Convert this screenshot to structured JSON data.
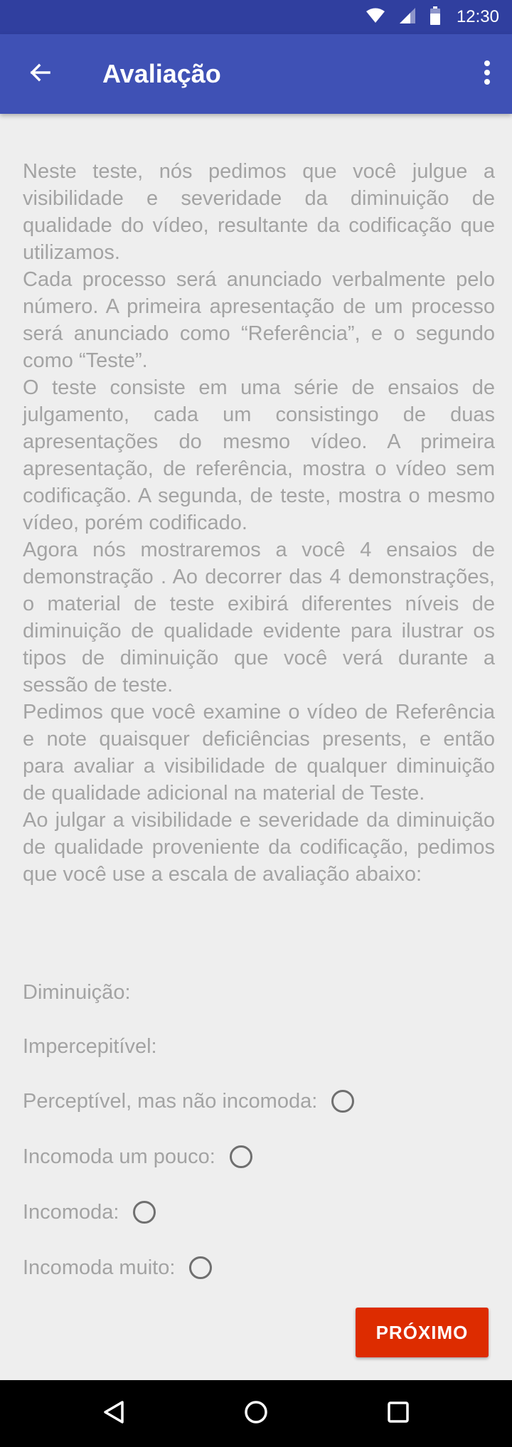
{
  "status_bar": {
    "time": "12:30",
    "icons": [
      "wifi-icon",
      "signal-icon",
      "battery-icon"
    ]
  },
  "app_bar": {
    "title": "Avaliação",
    "back_icon": "arrow-back-icon",
    "menu_icon": "more-vert-icon"
  },
  "instructions": [
    "Neste teste, nós pedimos que você julgue a visibilidade e severidade da diminuição de qualidade do vídeo, resultante da codificação que utilizamos.",
    "Cada processo será anunciado verbalmente pelo número. A primeira apresentação de um processo será anunciado como “Referência”, e o segundo como “Teste”.",
    "O teste consiste em uma série de ensaios de julgamento, cada um consistingo de duas apresentações do mesmo vídeo. A primeira apresentação, de referência, mostra o vídeo sem codificação. A segunda, de teste, mostra o mesmo vídeo, porém codificado.",
    "Agora nós mostraremos a você 4 ensaios de demonstração . Ao decorrer das 4 demonstrações, o material de teste exibirá diferentes níveis de diminuição de qualidade evidente para ilustrar os tipos de diminuição que você verá durante a sessão de teste.",
    "Pedimos que você examine o vídeo de Referência e note quaisquer deficiências presents, e então para avaliar a visibilidade de qualquer diminuição de qualidade adicional na material de Teste.",
    "Ao julgar a visibilidade e severidade da diminuição de qualidade proveniente da codificação, pedimos que você use a escala de avaliação abaixo:"
  ],
  "scale": {
    "heading": "Diminuição:",
    "imperceptible_label": "Impercepitível:",
    "options": [
      {
        "label": "Perceptível, mas não incomoda:",
        "selected": false
      },
      {
        "label": "Incomoda um pouco:",
        "selected": false
      },
      {
        "label": "Incomoda:",
        "selected": false
      },
      {
        "label": "Incomoda muito:",
        "selected": false
      }
    ]
  },
  "next_button": {
    "label": "PRÓXIMO",
    "color": "#dd2c00"
  },
  "nav_bar": {
    "icons": [
      "back-triangle-icon",
      "home-circle-icon",
      "recents-square-icon"
    ]
  },
  "colors": {
    "status_bar": "#303f9f",
    "app_bar": "#3f51b5",
    "background": "#eeeeee",
    "text": "#a3a3a3"
  }
}
